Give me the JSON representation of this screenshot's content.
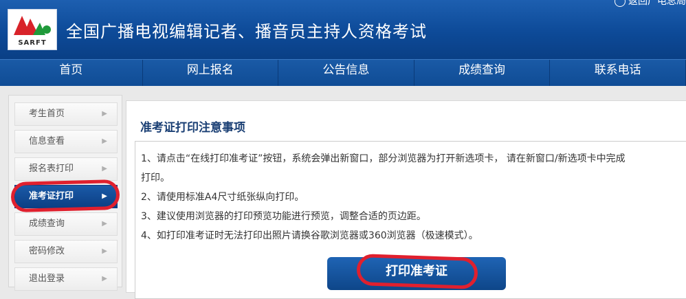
{
  "header": {
    "logo_text": "SARFT",
    "site_title": "全国广播电视编辑记者、播音员主持人资格考试",
    "top_link": "返回广电总局首"
  },
  "nav": {
    "items": [
      {
        "label": "首页"
      },
      {
        "label": "网上报名"
      },
      {
        "label": "公告信息"
      },
      {
        "label": "成绩查询"
      },
      {
        "label": "联系电话"
      }
    ]
  },
  "sidebar": {
    "items": [
      {
        "label": "考生首页",
        "arrow": "▶"
      },
      {
        "label": "信息查看",
        "arrow": "▶"
      },
      {
        "label": "报名表打印",
        "arrow": "▶"
      },
      {
        "label": "准考证打印",
        "arrow": "▶",
        "active": true
      },
      {
        "label": "成绩查询",
        "arrow": "▶"
      },
      {
        "label": "密码修改",
        "arrow": "▶"
      },
      {
        "label": "退出登录",
        "arrow": "▶"
      }
    ]
  },
  "main": {
    "title": "准考证打印注意事项",
    "notices": [
      "1、请点击“在线打印准考证”按钮，系统会弹出新窗口，部分浏览器为打开新选项卡， 请在新窗口/新选项卡中完成",
      "打印。",
      "2、请使用标准A4尺寸纸张纵向打印。",
      "3、建议使用浏览器的打印预览功能进行预览，调整合适的页边距。",
      "4、如打印准考证时无法打印出照片请换谷歌浏览器或360浏览器（极速模式）。"
    ],
    "print_button": "打印准考证"
  },
  "colors": {
    "brand_blue": "#0d4a98",
    "highlight_red": "#e0202e"
  }
}
